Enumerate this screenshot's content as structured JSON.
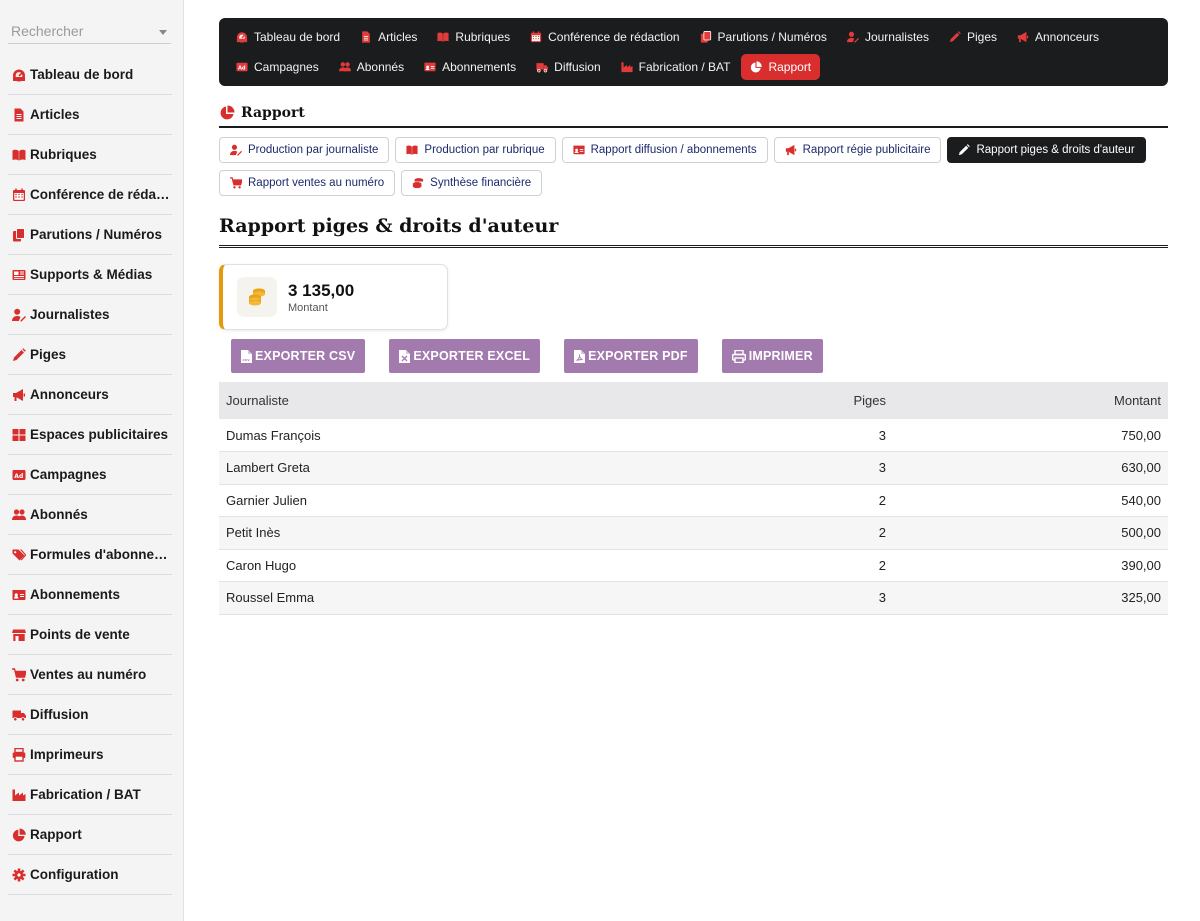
{
  "search": {
    "placeholder": "Rechercher"
  },
  "sidebar": {
    "items": [
      {
        "label": "Tableau de bord",
        "icon": "dashboard-icon"
      },
      {
        "label": "Articles",
        "icon": "file-icon"
      },
      {
        "label": "Rubriques",
        "icon": "book-icon"
      },
      {
        "label": "Conférence de rédac…",
        "icon": "calendar-icon"
      },
      {
        "label": "Parutions / Numéros",
        "icon": "copy-icon"
      },
      {
        "label": "Supports & Médias",
        "icon": "newspaper-icon"
      },
      {
        "label": "Journalistes",
        "icon": "user-pen-icon"
      },
      {
        "label": "Piges",
        "icon": "pen-icon"
      },
      {
        "label": "Annonceurs",
        "icon": "megaphone-icon"
      },
      {
        "label": "Espaces publicitaires",
        "icon": "grid-icon"
      },
      {
        "label": "Campagnes",
        "icon": "ad-icon"
      },
      {
        "label": "Abonnés",
        "icon": "users-icon"
      },
      {
        "label": "Formules d'abonne…",
        "icon": "tags-icon"
      },
      {
        "label": "Abonnements",
        "icon": "id-card-icon"
      },
      {
        "label": "Points de vente",
        "icon": "store-icon"
      },
      {
        "label": "Ventes au numéro",
        "icon": "cart-icon"
      },
      {
        "label": "Diffusion",
        "icon": "truck-icon"
      },
      {
        "label": "Imprimeurs",
        "icon": "printer-icon"
      },
      {
        "label": "Fabrication / BAT",
        "icon": "industry-icon"
      },
      {
        "label": "Rapport",
        "icon": "pie-chart-icon"
      },
      {
        "label": "Configuration",
        "icon": "gear-icon"
      }
    ]
  },
  "topnav": {
    "row1": [
      {
        "label": "Tableau de bord",
        "icon": "dashboard-icon"
      },
      {
        "label": "Articles",
        "icon": "file-icon"
      },
      {
        "label": "Rubriques",
        "icon": "book-icon"
      },
      {
        "label": "Conférence de rédaction",
        "icon": "calendar-icon"
      },
      {
        "label": "Parutions / Numéros",
        "icon": "copy-icon"
      },
      {
        "label": "Journalistes",
        "icon": "user-pen-icon"
      },
      {
        "label": "Piges",
        "icon": "pen-icon"
      },
      {
        "label": "Annonceurs",
        "icon": "megaphone-icon"
      }
    ],
    "row2": [
      {
        "label": "Campagnes",
        "icon": "ad-icon"
      },
      {
        "label": "Abonnés",
        "icon": "users-icon"
      },
      {
        "label": "Abonnements",
        "icon": "id-card-icon"
      },
      {
        "label": "Diffusion",
        "icon": "truck-icon"
      },
      {
        "label": "Fabrication / BAT",
        "icon": "industry-icon"
      },
      {
        "label": "Rapport",
        "icon": "pie-chart-icon",
        "active": true
      }
    ]
  },
  "section": {
    "title": "Rapport"
  },
  "subtabs": {
    "row1": [
      {
        "label": "Production par journaliste",
        "icon": "user-pen-icon"
      },
      {
        "label": "Production par rubrique",
        "icon": "book-icon"
      },
      {
        "label": "Rapport diffusion / abonnements",
        "icon": "id-card-icon"
      },
      {
        "label": "Rapport régie publicitaire",
        "icon": "megaphone-icon"
      },
      {
        "label": "Rapport piges & droits d'auteur",
        "icon": "pen-icon",
        "active": true
      }
    ],
    "row2": [
      {
        "label": "Rapport ventes au numéro",
        "icon": "cart-icon"
      },
      {
        "label": "Synthèse financière",
        "icon": "coins-icon"
      }
    ]
  },
  "report": {
    "title": "Rapport piges & droits d'auteur"
  },
  "stat": {
    "value": "3 135,00",
    "label": "Montant",
    "icon": "coins-icon",
    "accent": "#e59a0e"
  },
  "actions": {
    "csv": "EXPORTER CSV",
    "excel": "EXPORTER EXCEL",
    "pdf": "EXPORTER PDF",
    "print": "IMPRIMER"
  },
  "table": {
    "headers": {
      "journaliste": "Journaliste",
      "piges": "Piges",
      "montant": "Montant"
    },
    "rows": [
      {
        "journaliste": "Dumas François",
        "piges": "3",
        "montant": "750,00"
      },
      {
        "journaliste": "Lambert Greta",
        "piges": "3",
        "montant": "630,00"
      },
      {
        "journaliste": "Garnier Julien",
        "piges": "2",
        "montant": "540,00"
      },
      {
        "journaliste": "Petit Inès",
        "piges": "2",
        "montant": "500,00"
      },
      {
        "journaliste": "Caron Hugo",
        "piges": "2",
        "montant": "390,00"
      },
      {
        "journaliste": "Roussel Emma",
        "piges": "3",
        "montant": "325,00"
      }
    ]
  },
  "colors": {
    "brand": "#d92e2e",
    "dark": "#1b1c1e",
    "button": "#a27aae",
    "link": "#1b2a6b"
  }
}
